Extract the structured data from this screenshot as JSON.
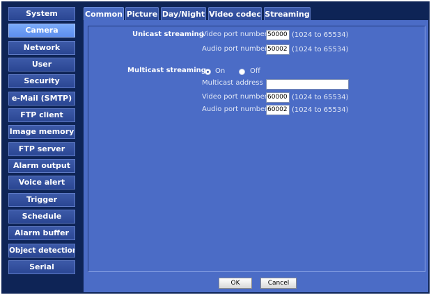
{
  "sidebar": {
    "items": [
      {
        "label": "System"
      },
      {
        "label": "Camera",
        "active": true
      },
      {
        "label": "Network"
      },
      {
        "label": "User"
      },
      {
        "label": "Security"
      },
      {
        "label": "e-Mail (SMTP)"
      },
      {
        "label": "FTP client"
      },
      {
        "label": "Image memory"
      },
      {
        "label": "FTP server"
      },
      {
        "label": "Alarm output"
      },
      {
        "label": "Voice alert"
      },
      {
        "label": "Trigger"
      },
      {
        "label": "Schedule"
      },
      {
        "label": "Alarm buffer"
      },
      {
        "label": "Object detection"
      },
      {
        "label": "Serial"
      }
    ]
  },
  "tabs": {
    "common": "Common",
    "picture": "Picture",
    "day_night": "Day/Night",
    "video_codec": "Video codec",
    "streaming": "Streaming",
    "active": "common"
  },
  "unicast": {
    "title": "Unicast streaming",
    "video_label": "Video port number",
    "video_value": "50000",
    "video_range": "(1024 to 65534)",
    "audio_label": "Audio port number",
    "audio_value": "50002",
    "audio_range": "(1024 to 65534)"
  },
  "multicast": {
    "title": "Multicast streaming",
    "on_label": "On",
    "off_label": "Off",
    "selected": "on",
    "address_label": "Multicast address",
    "address_value": "",
    "video_label": "Video port number",
    "video_value": "60000",
    "video_range": "(1024 to 65534)",
    "audio_label": "Audio port number",
    "audio_value": "60002",
    "audio_range": "(1024 to 65534)"
  },
  "footer": {
    "ok_label": "OK",
    "cancel_label": "Cancel"
  },
  "colors": {
    "background": "#0e2456",
    "panel": "#4b6cc6",
    "sidebar_button": "#2a4693",
    "sidebar_active": "#6a9af4"
  }
}
